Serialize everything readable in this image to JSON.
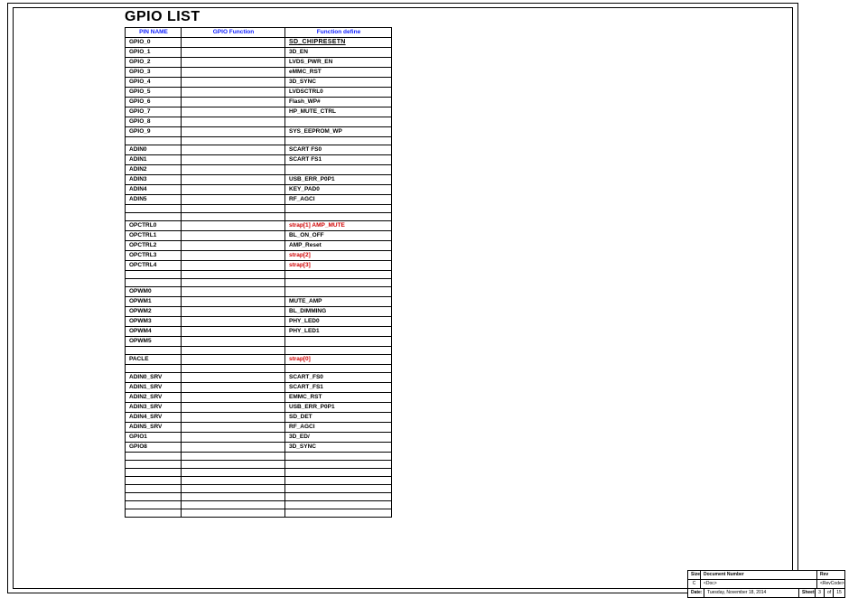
{
  "title": "GPIO LIST",
  "headers": {
    "c1": "PIN NAME",
    "c2": "GPIO Function",
    "c3": "Function define"
  },
  "rows": [
    {
      "pin": "GPIO_0",
      "gf": "",
      "fn": "SD_CHIPRESETN",
      "style": "bold8"
    },
    {
      "pin": "GPIO_1",
      "gf": "",
      "fn": "3D_EN"
    },
    {
      "pin": "GPIO_2",
      "gf": "",
      "fn": "LVDS_PWR_EN"
    },
    {
      "pin": "GPIO_3",
      "gf": "",
      "fn": "eMMC_RST"
    },
    {
      "pin": "GPIO_4",
      "gf": "",
      "fn": "3D_SYNC"
    },
    {
      "pin": "GPIO_5",
      "gf": "",
      "fn": "LVDSCTRL0"
    },
    {
      "pin": "GPIO_6",
      "gf": "",
      "fn": "Flash_WP#"
    },
    {
      "pin": "GPIO_7",
      "gf": "",
      "fn": "HP_MUTE_CTRL"
    },
    {
      "pin": "GPIO_8",
      "gf": "",
      "fn": ""
    },
    {
      "pin": "GPIO_9",
      "gf": "",
      "fn": "SYS_EEPROM_WP"
    },
    {
      "pin": "",
      "gf": "",
      "fn": ""
    },
    {
      "pin": "ADIN0",
      "gf": "",
      "fn": "SCART FS0"
    },
    {
      "pin": "ADIN1",
      "gf": "",
      "fn": "SCART FS1"
    },
    {
      "pin": "ADIN2",
      "gf": "",
      "fn": ""
    },
    {
      "pin": "ADIN3",
      "gf": "",
      "fn": "USB_ERR_P0P1"
    },
    {
      "pin": "ADIN4",
      "gf": "",
      "fn": "KEY_PAD0"
    },
    {
      "pin": "ADIN5",
      "gf": "",
      "fn": "RF_AGCI"
    },
    {
      "pin": "",
      "gf": "",
      "fn": ""
    },
    {
      "pin": "",
      "gf": "",
      "fn": ""
    },
    {
      "pin": "OPCTRL0",
      "gf": "",
      "fn": "strap[1]   AMP_MUTE",
      "style": "red"
    },
    {
      "pin": "OPCTRL1",
      "gf": "",
      "fn": "BL_ON_OFF"
    },
    {
      "pin": "OPCTRL2",
      "gf": "",
      "fn": "AMP_Reset"
    },
    {
      "pin": "OPCTRL3",
      "gf": "",
      "fn": "strap[2]",
      "style": "red"
    },
    {
      "pin": "OPCTRL4",
      "gf": "",
      "fn": "strap[3]",
      "style": "red"
    },
    {
      "pin": "",
      "gf": "",
      "fn": ""
    },
    {
      "pin": "",
      "gf": "",
      "fn": ""
    },
    {
      "pin": "OPWM0",
      "gf": "",
      "fn": ""
    },
    {
      "pin": "OPWM1",
      "gf": "",
      "fn": "MUTE_AMP"
    },
    {
      "pin": "OPWM2",
      "gf": "",
      "fn": "BL_DIMMING"
    },
    {
      "pin": "OPWM3",
      "gf": "",
      "fn": "PHY_LED0"
    },
    {
      "pin": "OPWM4",
      "gf": "",
      "fn": "PHY_LED1"
    },
    {
      "pin": "OPWM5",
      "gf": "",
      "fn": ""
    },
    {
      "pin": "",
      "gf": "",
      "fn": ""
    },
    {
      "pin": "PACLE",
      "gf": "",
      "fn": "strap[0]",
      "style": "red"
    },
    {
      "pin": "",
      "gf": "",
      "fn": ""
    },
    {
      "pin": "ADIN0_SRV",
      "gf": "",
      "fn": "SCART_FS0"
    },
    {
      "pin": "ADIN1_SRV",
      "gf": "",
      "fn": "SCART_FS1"
    },
    {
      "pin": "ADIN2_SRV",
      "gf": "",
      "fn": "EMMC_RST"
    },
    {
      "pin": "ADIN3_SRV",
      "gf": "",
      "fn": "USB_ERR_P0P1"
    },
    {
      "pin": "ADIN4_SRV",
      "gf": "",
      "fn": "SD_DET"
    },
    {
      "pin": "ADIN5_SRV",
      "gf": "",
      "fn": "RF_AGCI"
    },
    {
      "pin": "GPIO1",
      "gf": "",
      "fn": "3D_ED/"
    },
    {
      "pin": "GPIO8",
      "gf": "",
      "fn": "3D_SYNC"
    },
    {
      "pin": "",
      "gf": "",
      "fn": ""
    },
    {
      "pin": "",
      "gf": "",
      "fn": ""
    },
    {
      "pin": "",
      "gf": "",
      "fn": ""
    },
    {
      "pin": "",
      "gf": "",
      "fn": ""
    },
    {
      "pin": "",
      "gf": "",
      "fn": ""
    },
    {
      "pin": "",
      "gf": "",
      "fn": ""
    },
    {
      "pin": "",
      "gf": "",
      "fn": ""
    },
    {
      "pin": "",
      "gf": "",
      "fn": ""
    }
  ],
  "titleblock": {
    "size_label": "Size",
    "size": "C",
    "doc_label": "Document Number",
    "doc": "<Doc>",
    "rev_label": "Rev",
    "rev": "<RevCode>",
    "date_label": "Date:",
    "date": "Tuesday, November 18, 2014",
    "sheet_label": "Sheet",
    "sheet_cur": "3",
    "sheet_of": "of",
    "sheet_total": "15"
  }
}
